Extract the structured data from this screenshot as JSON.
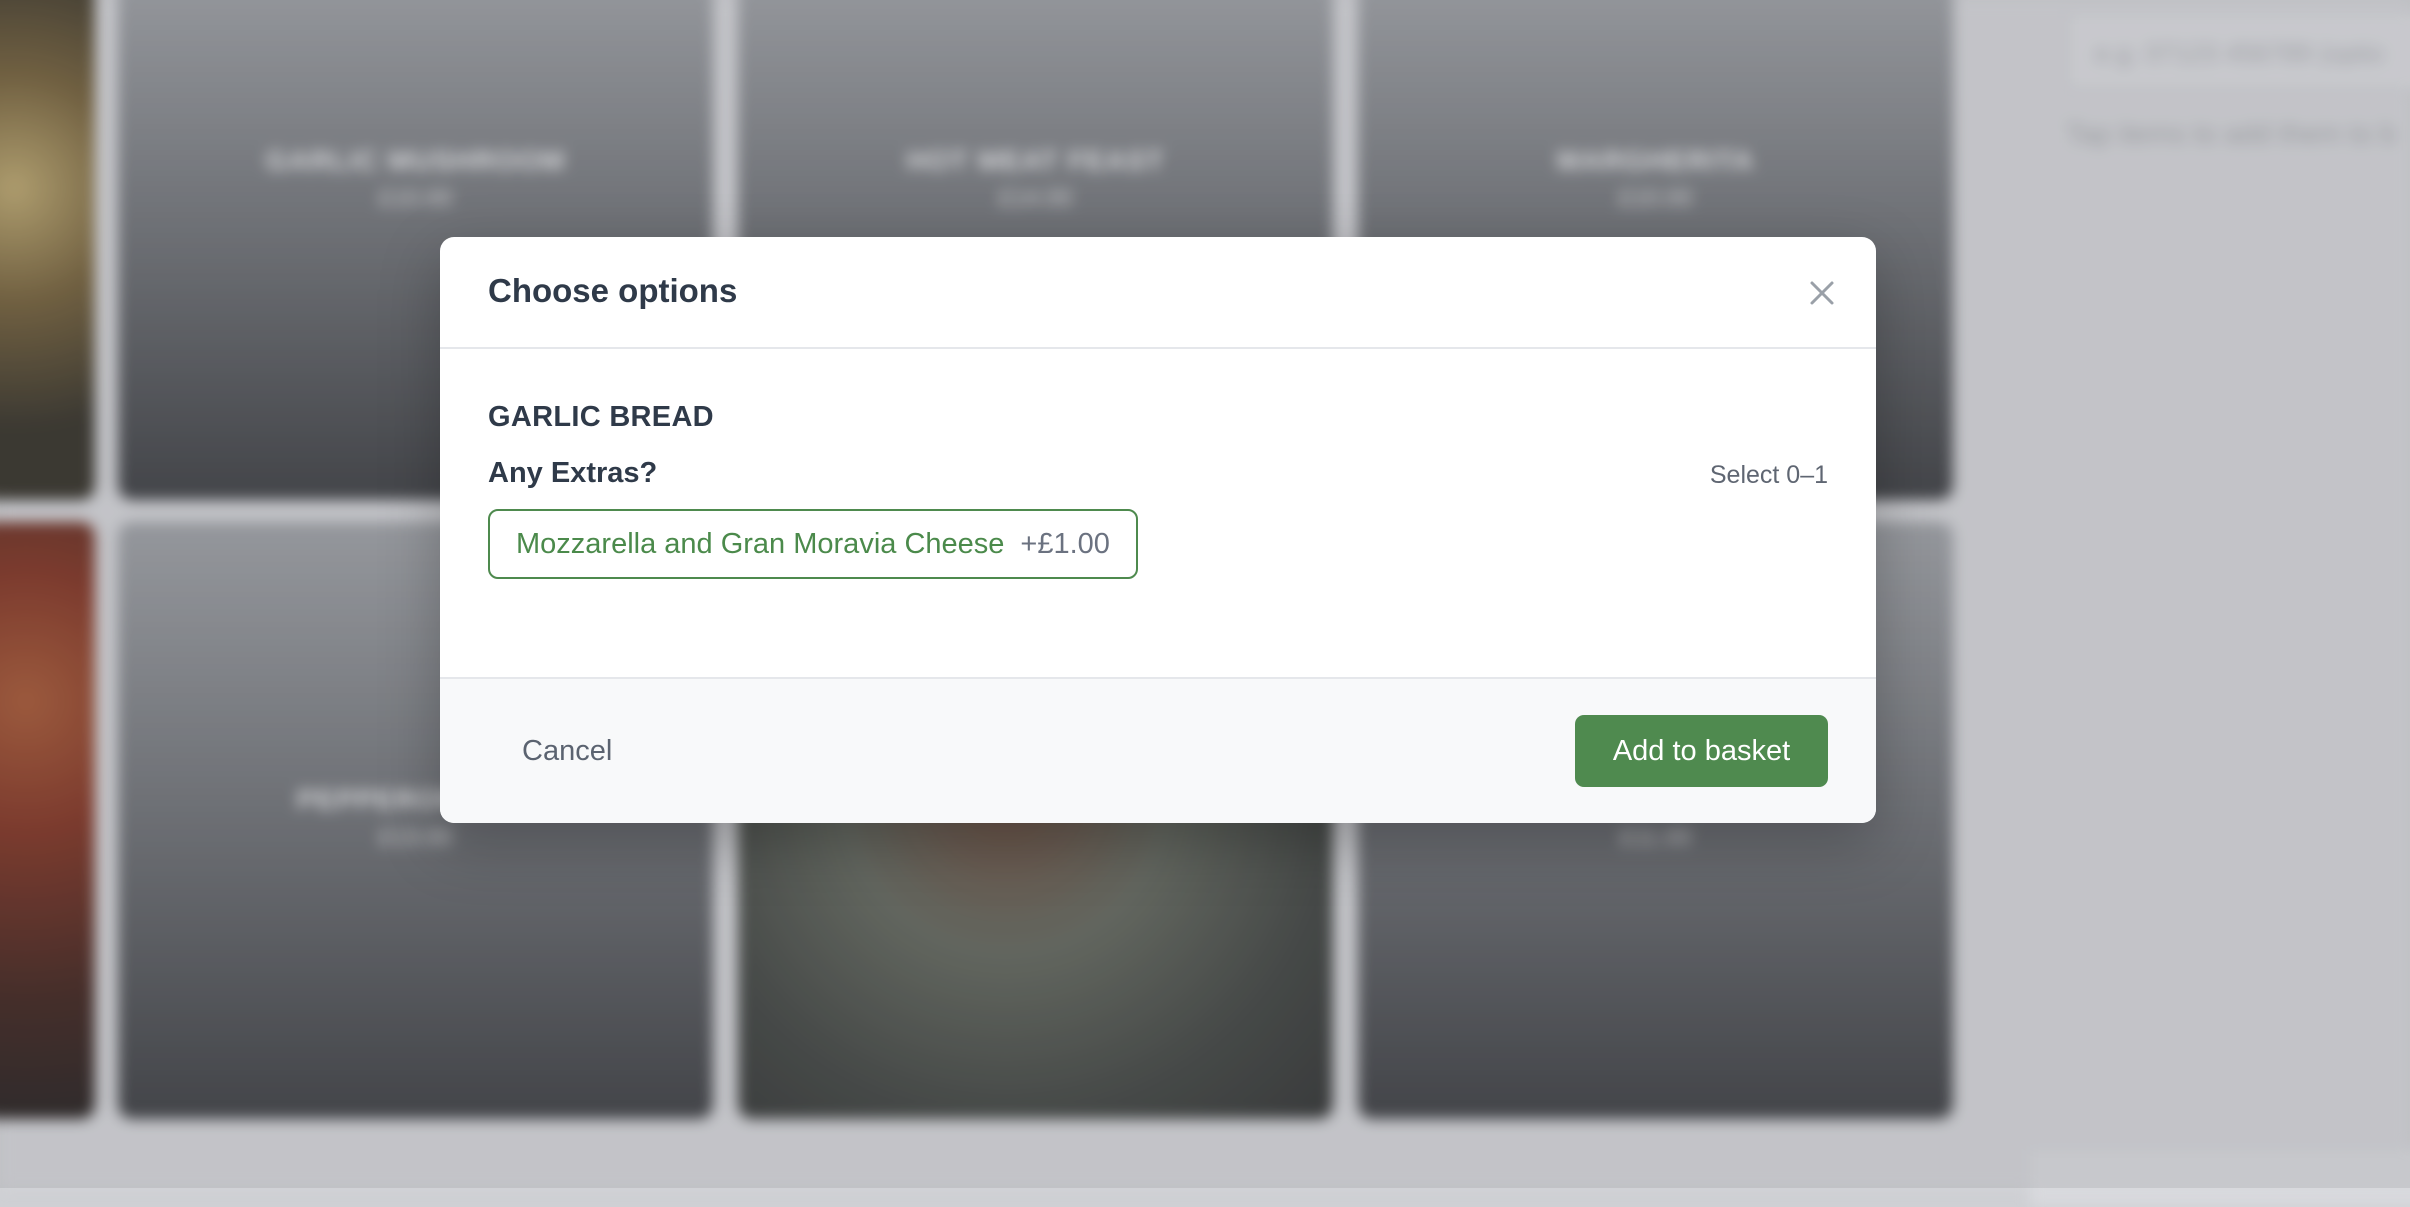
{
  "background": {
    "menu_tiles": [
      {
        "name": "GARLIC MUSHROOM",
        "price": "£10.00"
      },
      {
        "name": "HOT MEAT FEAST",
        "price": "£14.00"
      },
      {
        "name": "MARGHERITA",
        "price": "£10.00"
      },
      {
        "name": "PEPPERONI & ...",
        "price": "£13.00"
      },
      {
        "name": "",
        "price": ""
      },
      {
        "name": "",
        "price": "£11.00"
      }
    ],
    "side_panel": {
      "input_placeholder": "e.g. 07123 456789 (optio",
      "hint": "Tap items to add them to b"
    }
  },
  "modal": {
    "title": "Choose options",
    "close_icon": "close-icon",
    "item_name": "GARLIC BREAD",
    "option_group": {
      "title": "Any Extras?",
      "rule": "Select 0–1",
      "options": [
        {
          "label": "Mozzarella and Gran Moravia Cheese",
          "price": "+£1.00"
        }
      ]
    },
    "footer": {
      "cancel_label": "Cancel",
      "add_label": "Add to basket"
    }
  },
  "colors": {
    "accent": "#4f8a4f",
    "text_dark": "#2f3a49",
    "text_muted": "#5f6672"
  }
}
